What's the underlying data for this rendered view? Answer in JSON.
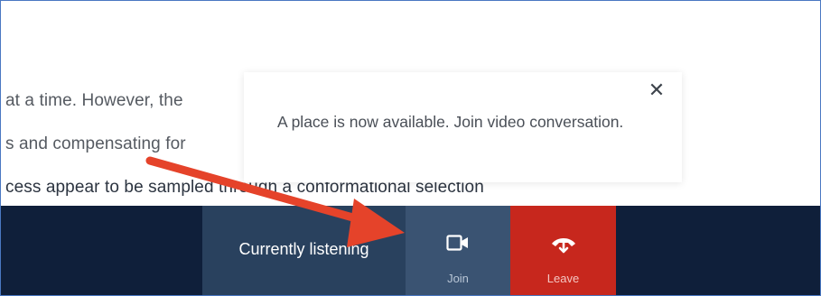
{
  "background_text": {
    "line1": "at a time. However, the",
    "line2": "s and compensating for",
    "line3": "cess appear to be sampled through a conformational selection"
  },
  "toast": {
    "message": "A place is now available. Join video conversation.",
    "close_icon": "close-icon"
  },
  "call_bar": {
    "status": "Currently listening",
    "join": {
      "label": "Join",
      "icon": "video-camera-icon"
    },
    "leave": {
      "label": "Leave",
      "icon": "hang-up-phone-icon"
    }
  },
  "colors": {
    "bar": "#0f1f3a",
    "status_box": "#29415e",
    "join_button": "#3a5372",
    "leave_button": "#c7271d",
    "annotation_arrow": "#e5432a"
  }
}
